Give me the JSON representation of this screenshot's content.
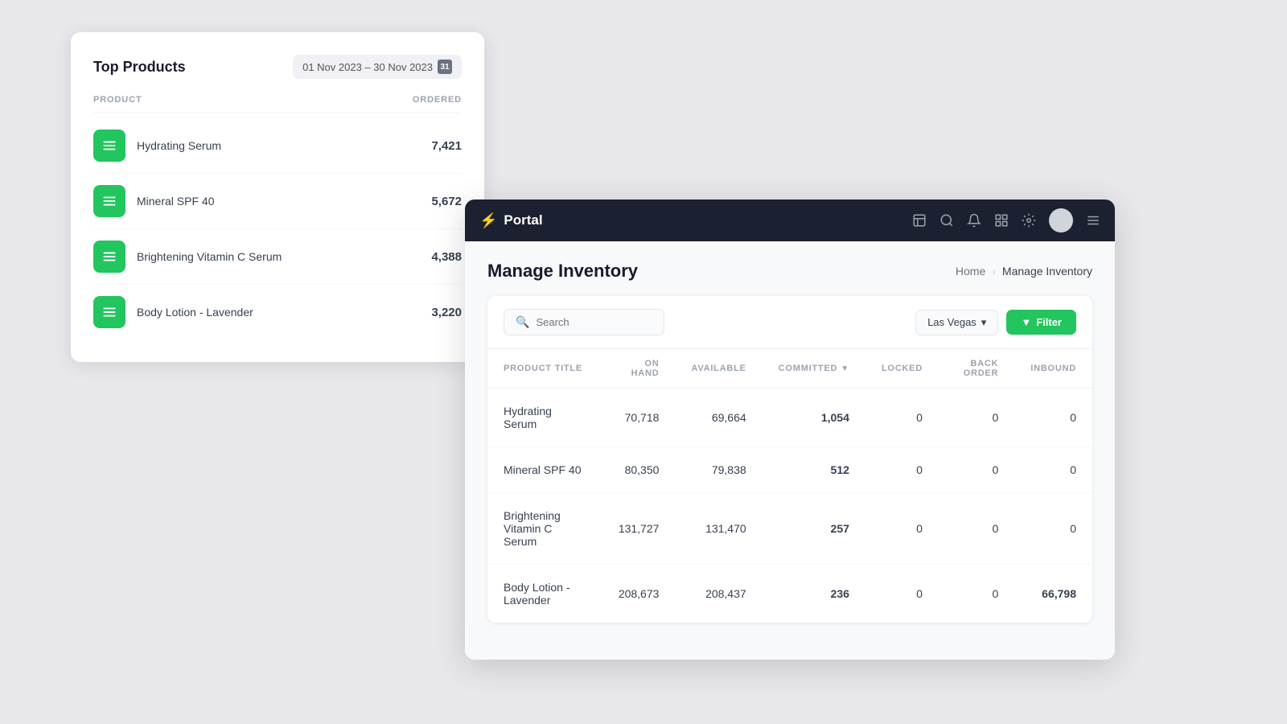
{
  "topProducts": {
    "title": "Top Products",
    "dateRange": "01 Nov 2023 – 30 Nov 2023",
    "dateIcon": "31",
    "columns": {
      "product": "PRODUCT",
      "ordered": "ORDERED"
    },
    "rows": [
      {
        "name": "Hydrating Serum",
        "qty": "7,421"
      },
      {
        "name": "Mineral SPF 40",
        "qty": "5,672"
      },
      {
        "name": "Brightening Vitamin C Serum",
        "qty": "4,388"
      },
      {
        "name": "Body Lotion - Lavender",
        "qty": "3,220"
      }
    ]
  },
  "portal": {
    "logo": "Portal",
    "nav": {
      "icons": [
        "inbox-icon",
        "search-icon",
        "bell-icon",
        "grid-icon",
        "settings-icon",
        "menu-icon"
      ]
    },
    "breadcrumb": {
      "home": "Home",
      "current": "Manage Inventory"
    },
    "pageTitle": "Manage Inventory",
    "toolbar": {
      "searchPlaceholder": "Search",
      "location": "Las Vegas",
      "filterLabel": "Filter"
    },
    "table": {
      "columns": [
        "PRODUCT TITLE",
        "ON HAND",
        "AVAILABLE",
        "COMMITTED",
        "LOCKED",
        "BACK ORDER",
        "INBOUND"
      ],
      "rows": [
        {
          "title": "Hydrating Serum",
          "onHand": "70,718",
          "available": "69,664",
          "committed": "1,054",
          "locked": "0",
          "backOrder": "0",
          "inbound": "0"
        },
        {
          "title": "Mineral SPF 40",
          "onHand": "80,350",
          "available": "79,838",
          "committed": "512",
          "locked": "0",
          "backOrder": "0",
          "inbound": "0"
        },
        {
          "title": "Brightening Vitamin C Serum",
          "onHand": "131,727",
          "available": "131,470",
          "committed": "257",
          "locked": "0",
          "backOrder": "0",
          "inbound": "0"
        },
        {
          "title": "Body Lotion - Lavender",
          "onHand": "208,673",
          "available": "208,437",
          "committed": "236",
          "locked": "0",
          "backOrder": "0",
          "inbound": "66,798"
        }
      ]
    }
  }
}
